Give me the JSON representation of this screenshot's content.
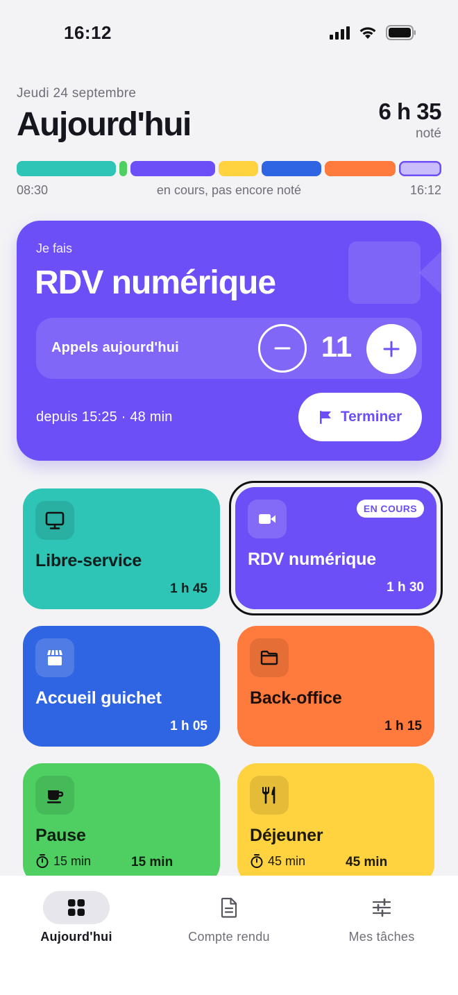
{
  "status_bar": {
    "time": "16:12"
  },
  "header": {
    "date": "Jeudi 24 septembre",
    "title": "Aujourd'hui",
    "total_value": "6 h 35",
    "total_label": "noté"
  },
  "timeline": {
    "start": "08:30",
    "middle": "en cours, pas encore noté",
    "end": "16:12",
    "segments": [
      {
        "color": "#2ec5b6",
        "weight": 105
      },
      {
        "color": "#4fcf62",
        "weight": 8
      },
      {
        "color": "#6c4ff6",
        "weight": 90
      },
      {
        "color": "#ffd23f",
        "weight": 42
      },
      {
        "color": "#2f64e2",
        "weight": 63
      },
      {
        "color": "#ff7b3d",
        "weight": 75
      },
      {
        "color": "#c9bdfb",
        "weight": 45,
        "outline": "#6c4ff6"
      }
    ]
  },
  "current": {
    "label": "Je fais",
    "title": "RDV numérique",
    "counter_label": "Appels aujourd'hui",
    "count": "11",
    "since": "depuis 15:25 · 48 min",
    "finish_label": "Terminer",
    "color": "#6c4ff6"
  },
  "tasks": [
    {
      "name": "Libre-service",
      "duration": "1 h 45",
      "icon": "monitor-icon",
      "color": "#2ec5b6"
    },
    {
      "name": "RDV numérique",
      "duration": "1 h 30",
      "icon": "video-camera-icon",
      "color": "#6c4ff6",
      "badge": "EN COURS"
    },
    {
      "name": "Accueil guichet",
      "duration": "1 h 05",
      "icon": "storefront-icon",
      "color": "#2f64e2"
    },
    {
      "name": "Back-office",
      "duration": "1 h 15",
      "icon": "folder-icon",
      "color": "#ff7b3d"
    },
    {
      "name": "Pause",
      "planned": "15 min",
      "duration": "15 min",
      "icon": "coffee-cup-icon",
      "color": "#4fcf62"
    },
    {
      "name": "Déjeuner",
      "planned": "45 min",
      "duration": "45 min",
      "icon": "fork-knife-icon",
      "color": "#ffd23f"
    }
  ],
  "nav": {
    "today": "Aujourd'hui",
    "report": "Compte rendu",
    "tasks": "Mes tâches"
  }
}
